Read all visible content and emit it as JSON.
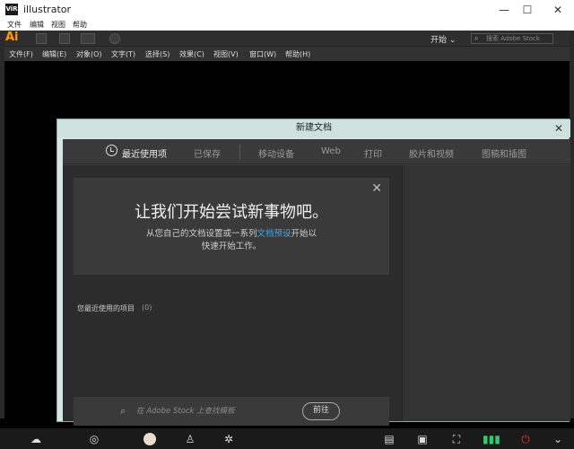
{
  "window": {
    "title": "illustrator",
    "app_icon": "ViR",
    "min": "—",
    "max": "☐",
    "close": "✕"
  },
  "sys_menu": [
    "文件",
    "编辑",
    "视图",
    "帮助"
  ],
  "app_toolbar": {
    "logo": "Ai",
    "workspace": "开始",
    "chev": "⌄",
    "search_placeholder": "搜索 Adobe Stock"
  },
  "app_menu": [
    "文件(F)",
    "编辑(E)",
    "对象(O)",
    "文字(T)",
    "选择(S)",
    "效果(C)",
    "视图(V)",
    "窗口(W)",
    "帮助(H)"
  ],
  "dialog": {
    "title": "新建文档",
    "close": "✕",
    "tabs": [
      "最近使用项",
      "已保存",
      "移动设备",
      "Web",
      "打印",
      "胶片和视频",
      "图稿和插图"
    ],
    "welcome": {
      "title": "让我们开始尝试新事物吧。",
      "line1_pre": "从您自己的文档设置或一系列",
      "line1_link": "文档预设",
      "line1_post": "开始以",
      "line2": "快速开始工作。",
      "close": "✕"
    },
    "recent_label": "您最近使用的项目",
    "recent_count": "(0)",
    "stock_search_placeholder": "在 Adobe Stock 上查找模板",
    "go_button": "前往"
  },
  "colors": {
    "accent_link": "#4aa3df",
    "dialog_header": "#cfe1dd",
    "ai_logo": "#ff9a00"
  }
}
